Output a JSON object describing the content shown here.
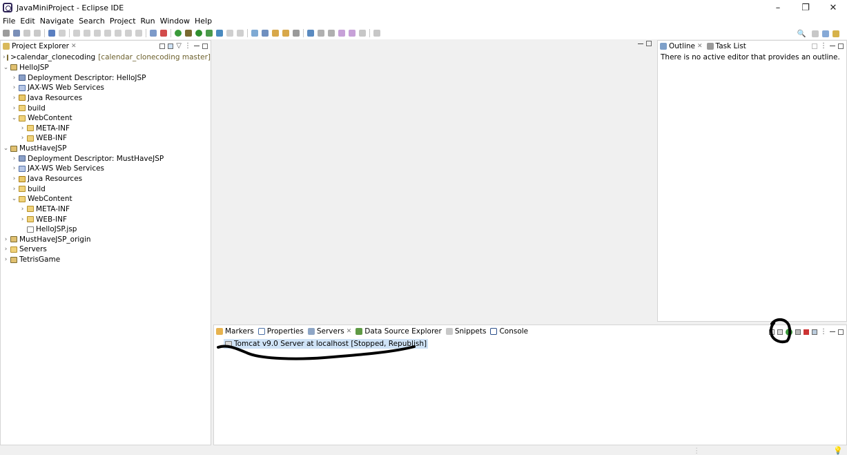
{
  "window": {
    "title": "JavaMiniProject - Eclipse IDE"
  },
  "menu": [
    "File",
    "Edit",
    "Navigate",
    "Search",
    "Project",
    "Run",
    "Window",
    "Help"
  ],
  "project_explorer": {
    "tab_label": "Project Explorer",
    "items": [
      {
        "prefix": "> ",
        "label": "calendar_clonecoding",
        "git": "[calendar_clonecoding master]"
      },
      {
        "label": "HelloJSP"
      },
      {
        "label": "Deployment Descriptor: HelloJSP"
      },
      {
        "label": "JAX-WS Web Services"
      },
      {
        "label": "Java Resources"
      },
      {
        "label": "build"
      },
      {
        "label": "WebContent"
      },
      {
        "label": "META-INF"
      },
      {
        "label": "WEB-INF"
      },
      {
        "label": "MustHaveJSP"
      },
      {
        "label": "Deployment Descriptor: MustHaveJSP"
      },
      {
        "label": "JAX-WS Web Services"
      },
      {
        "label": "Java Resources"
      },
      {
        "label": "build"
      },
      {
        "label": "WebContent"
      },
      {
        "label": "META-INF"
      },
      {
        "label": "WEB-INF"
      },
      {
        "label": "HelloJSP.jsp"
      },
      {
        "label": "MustHaveJSP_origin"
      },
      {
        "label": "Servers"
      },
      {
        "label": "TetrisGame"
      }
    ]
  },
  "outline": {
    "tabs": [
      "Outline",
      "Task List"
    ],
    "message": "There is no active editor that provides an outline."
  },
  "bottom_panel": {
    "tabs": [
      "Markers",
      "Properties",
      "Servers",
      "Data Source Explorer",
      "Snippets",
      "Console"
    ],
    "server_entry": "Tomcat v9.0 Server at localhost  [Stopped, Republish]"
  }
}
